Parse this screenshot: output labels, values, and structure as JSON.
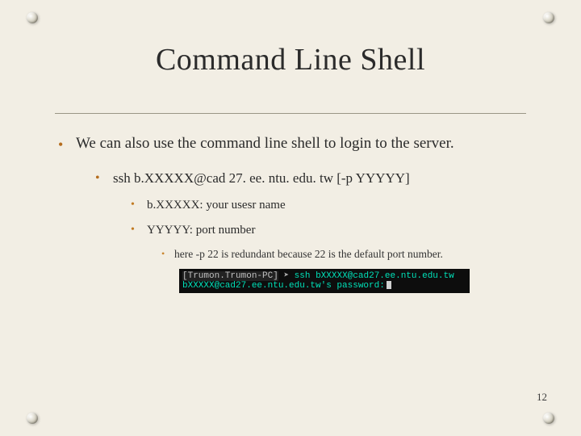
{
  "title": "Command Line Shell",
  "bullet_main": "We can also use the command line shell to login to the server.",
  "ssh_cmd": "ssh b.XXXXX@cad 27. ee. ntu. edu. tw [-p YYYYY]",
  "user_desc": "b.XXXXX: your usesr name",
  "port_desc": "YYYYY: port number",
  "port_note": "here -p 22 is redundant because 22 is the default port number.",
  "terminal": {
    "host": "[Trumon.Trumon-PC]",
    "arrow": "➤",
    "line1_cmd": "ssh bXXXXX@cad27.ee.ntu.edu.tw",
    "line2": "bXXXXX@cad27.ee.ntu.edu.tw's password:"
  },
  "page_number": "12"
}
